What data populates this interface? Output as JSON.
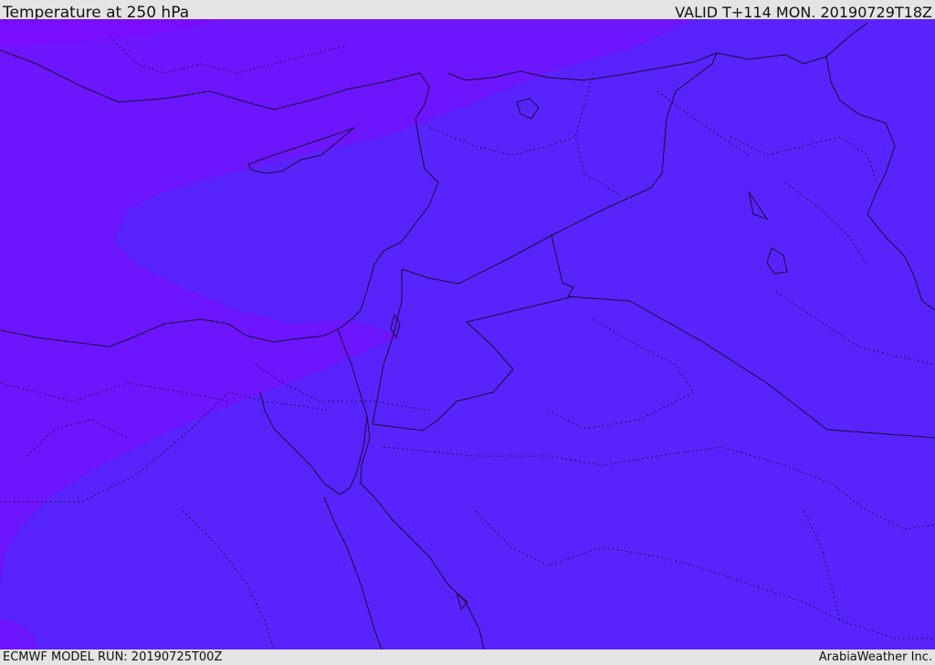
{
  "header": {
    "title": "Temperature at 250 hPa",
    "valid_time": "VALID T+114 MON. 20190729T18Z"
  },
  "footer": {
    "model_run": "ECMWF MODEL RUN: 20190725T00Z",
    "credit": "ArabiaWeather Inc."
  },
  "map": {
    "colors": {
      "band_warm": "#7414ff",
      "band_mid": "#6d15fd",
      "band_cool": "#5824fb",
      "coastline": "#1a0a3a"
    }
  }
}
